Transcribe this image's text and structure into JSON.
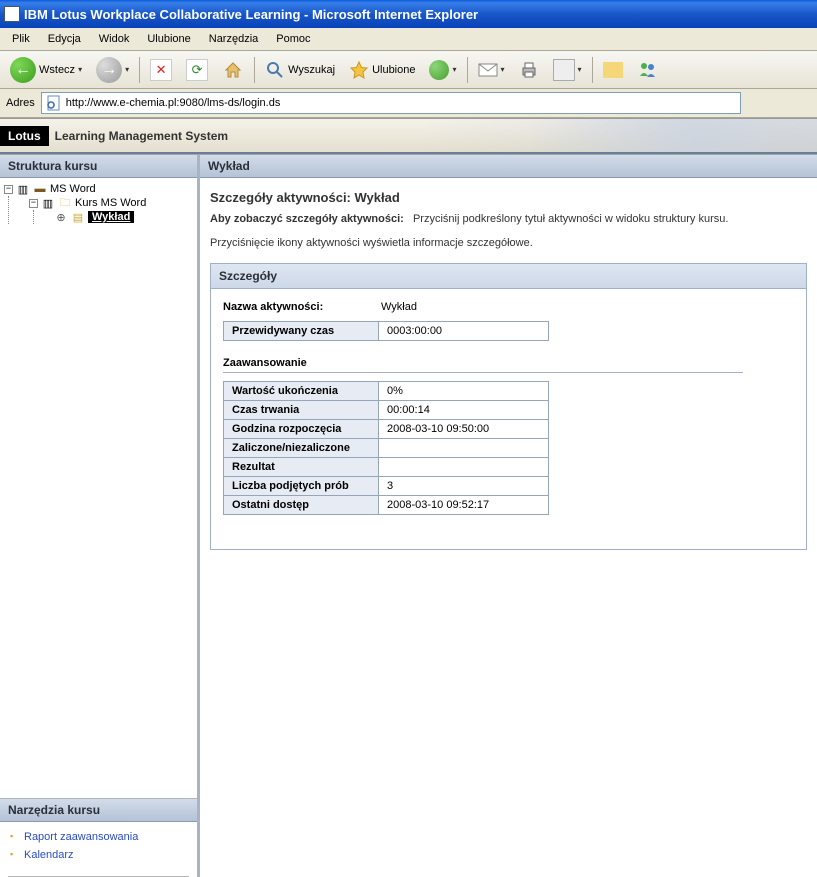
{
  "window": {
    "title": "IBM Lotus Workplace Collaborative Learning - Microsoft Internet Explorer"
  },
  "menubar": {
    "file": "Plik",
    "edit": "Edycja",
    "view": "Widok",
    "favorites": "Ulubione",
    "tools": "Narzędzia",
    "help": "Pomoc"
  },
  "toolbar": {
    "back": "Wstecz",
    "search": "Wyszukaj",
    "favorites": "Ulubione"
  },
  "addressbar": {
    "label": "Adres",
    "url": "http://www.e-chemia.pl:9080/lms-ds/login.ds"
  },
  "lotus": {
    "logo": "Lotus",
    "title": "Learning Management System"
  },
  "sidebar": {
    "structure_header": "Struktura kursu",
    "tree": {
      "root": "MS Word",
      "course": "Kurs MS Word",
      "activity": "Wykład"
    },
    "tools_header": "Narzędzia kursu",
    "tools": [
      "Raport zaawansowania",
      "Kalendarz"
    ]
  },
  "main": {
    "header": "Wykład",
    "subheader": "Szczegóły aktywności:  Wykład",
    "help_label": "Aby zobaczyć szczegóły aktywności:",
    "help_text": "Przyciśnij podkreślony tytuł aktywności w widoku struktury kursu.",
    "help2": "Przyciśnięcie ikony aktywności wyświetla informacje szczegółowe.",
    "details_header": "Szczegóły",
    "name_label": "Nazwa aktywności:",
    "name_value": "Wykład",
    "time_label": "Przewidywany czas",
    "time_value": "0003:00:00",
    "progress_header": "Zaawansowanie",
    "rows": {
      "completion_label": "Wartość ukończenia",
      "completion_value": "0%",
      "duration_label": "Czas trwania",
      "duration_value": "00:00:14",
      "start_label": "Godzina rozpoczęcia",
      "start_value": "2008-03-10 09:50:00",
      "passfail_label": "Zaliczone/niezaliczone",
      "passfail_value": "",
      "result_label": "Rezultat",
      "result_value": "",
      "attempts_label": "Liczba podjętych prób",
      "attempts_value": "3",
      "last_label": "Ostatni dostęp",
      "last_value": "2008-03-10 09:52:17"
    }
  }
}
